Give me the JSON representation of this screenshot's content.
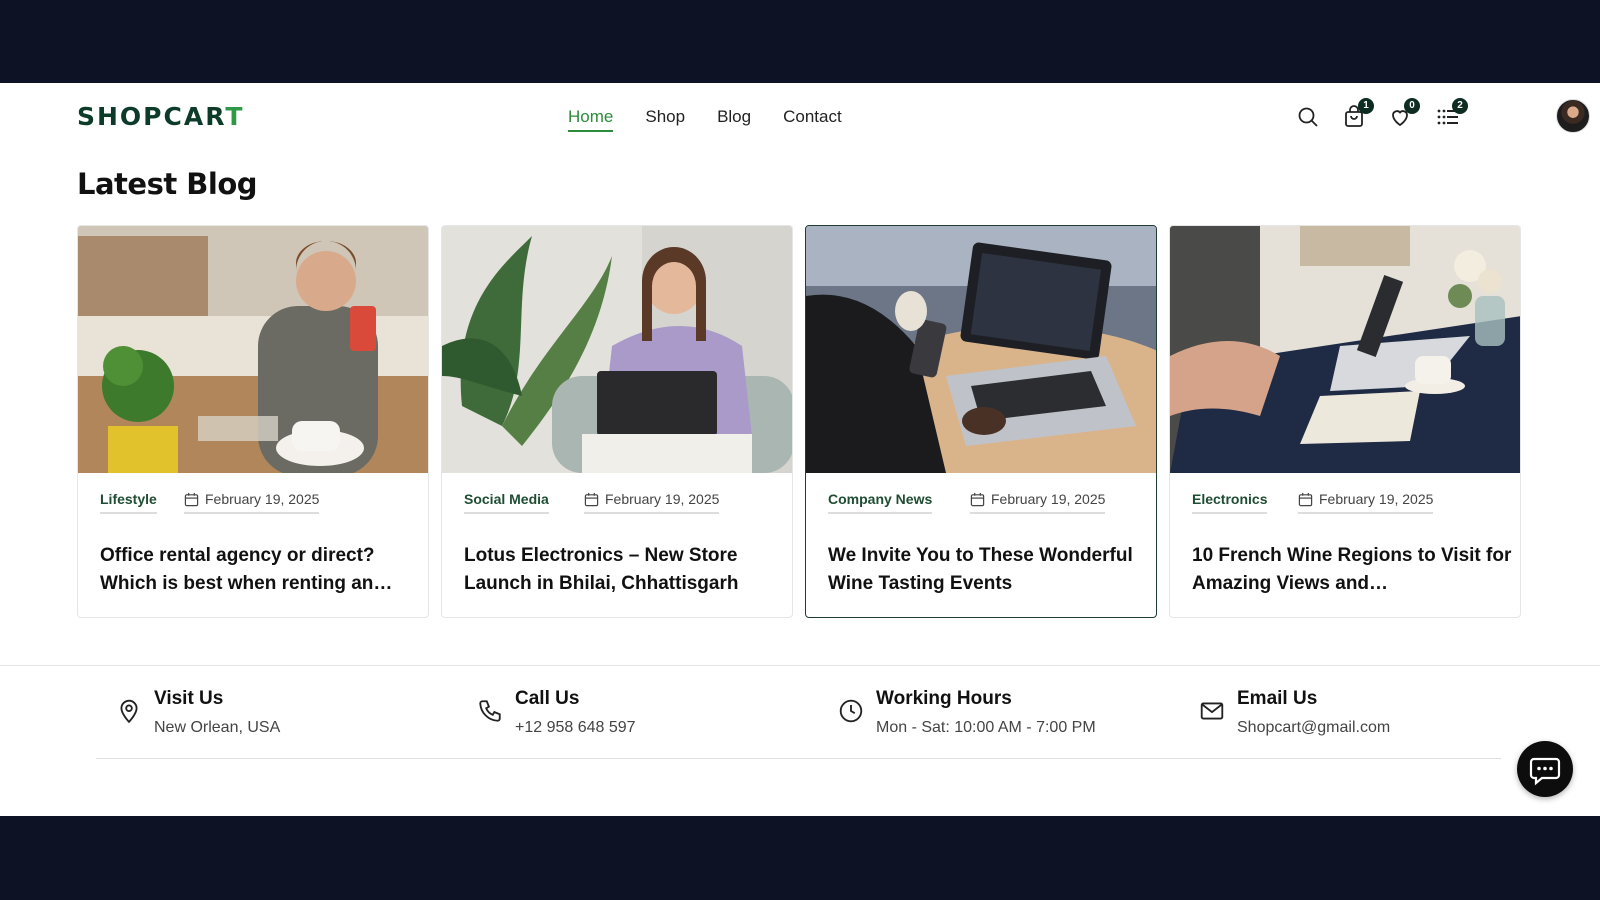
{
  "brand": {
    "logo_main": "SHOPCAR",
    "logo_accent": "T"
  },
  "nav": {
    "items": [
      "Home",
      "Shop",
      "Blog",
      "Contact"
    ],
    "active": "Home"
  },
  "header_actions": {
    "cart_badge": "1",
    "wishlist_badge": "0",
    "compare_badge": "2"
  },
  "section": {
    "title": "Latest Blog"
  },
  "posts": [
    {
      "category": "Lifestyle",
      "date": "February 19, 2025",
      "title": "Office rental agency or direct? Which is best when renting an…"
    },
    {
      "category": "Social Media",
      "date": "February 19, 2025",
      "title": "Lotus Electronics – New Store Launch in Bhilai, Chhattisgarh"
    },
    {
      "category": "Company News",
      "date": "February 19, 2025",
      "title": "We Invite You to These Wonderful Wine Tasting Events"
    },
    {
      "category": "Electronics",
      "date": "February 19, 2025",
      "title": "10 French Wine Regions to Visit for Amazing Views and…"
    }
  ],
  "contact": [
    {
      "label": "Visit Us",
      "value": "New Orlean, USA",
      "icon": "location-pin-icon"
    },
    {
      "label": "Call Us",
      "value": "+12 958 648 597",
      "icon": "phone-icon"
    },
    {
      "label": "Working Hours",
      "value": "Mon - Sat: 10:00 AM - 7:00 PM",
      "icon": "clock-icon"
    },
    {
      "label": "Email Us",
      "value": "Shopcart@gmail.com",
      "icon": "mail-icon"
    }
  ],
  "colors": {
    "accent": "#2e8b3c",
    "dark_green": "#0d3b2a",
    "letterbox": "#0d1324"
  }
}
